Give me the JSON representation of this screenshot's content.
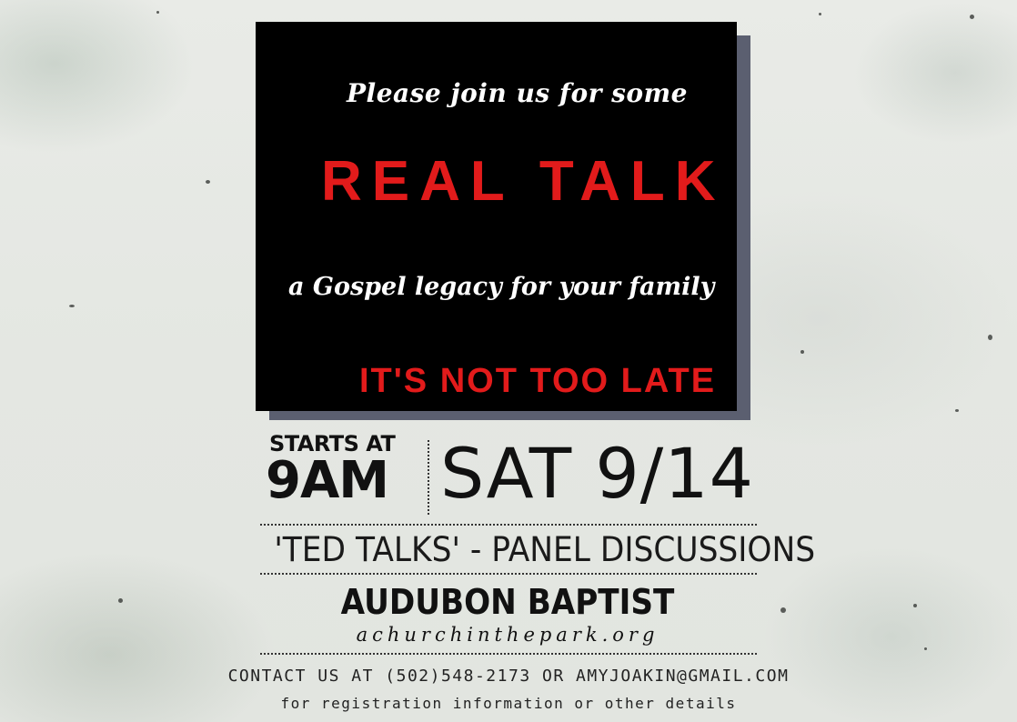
{
  "card": {
    "invite_line": "Please join us for some",
    "title": "REAL TALK",
    "tagline": "a Gospel legacy for your family",
    "urgency": "IT'S NOT TOO LATE"
  },
  "schedule": {
    "starts_label": "STARTS AT",
    "time": "9AM",
    "date": "SAT 9/14"
  },
  "event": {
    "format": "'TED TALKS' - PANEL DISCUSSIONS",
    "venue": "AUDUBON BAPTIST",
    "website": "achurchinthepark.org"
  },
  "contact": {
    "line": "CONTACT US AT (502)548-2173 OR AMYJOAKIN@GMAIL.COM",
    "note": "for registration information or other details"
  },
  "colors": {
    "card_background": "#000000",
    "accent_red": "#e21b1b",
    "card_shadow": "#5b5f70",
    "paper": "#e6e8e3"
  }
}
